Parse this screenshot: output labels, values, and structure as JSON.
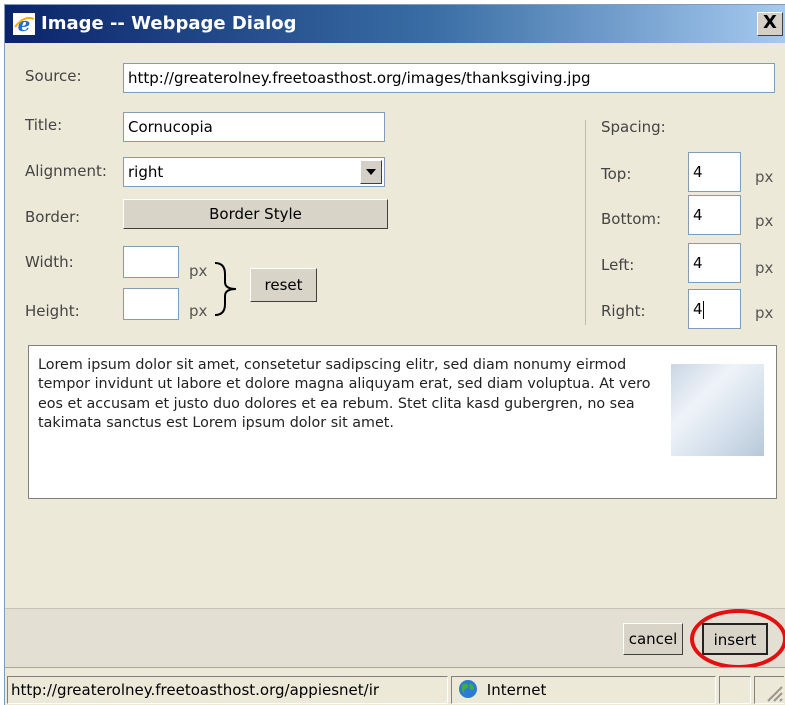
{
  "dialog": {
    "title": "Image -- Webpage Dialog",
    "close_label": "X"
  },
  "form": {
    "source_label": "Source:",
    "source_value": "http://greaterolney.freetoasthost.org/images/thanksgiving.jpg",
    "title_label": "Title:",
    "title_value": "Cornucopia",
    "alignment_label": "Alignment:",
    "alignment_value": "right",
    "border_label": "Border:",
    "border_button": "Border Style",
    "width_label": "Width:",
    "width_value": "",
    "height_label": "Height:",
    "height_value": "",
    "px_unit": "px",
    "reset_button": "reset"
  },
  "spacing": {
    "heading": "Spacing:",
    "top_label": "Top:",
    "top_value": "4",
    "bottom_label": "Bottom:",
    "bottom_value": "4",
    "left_label": "Left:",
    "left_value": "4",
    "right_label": "Right:",
    "right_value": "4",
    "unit": "px"
  },
  "preview": {
    "text": "Lorem ipsum dolor sit amet, consetetur sadipscing elitr, sed diam nonumy eirmod tempor invidunt ut labore et dolore magna aliquyam erat, sed diam voluptua. At vero eos et accusam et justo duo dolores et ea rebum. Stet clita kasd gubergren, no sea takimata sanctus est Lorem ipsum dolor sit amet."
  },
  "buttons": {
    "cancel": "cancel",
    "insert": "insert"
  },
  "statusbar": {
    "url": "http://greaterolney.freetoasthost.org/appiesnet/ir",
    "zone": "Internet"
  },
  "colors": {
    "titlebar_start": "#0a246a",
    "titlebar_end": "#a6caf0",
    "dialog_bg": "#ece9d8",
    "highlight_ring": "#e21010"
  }
}
